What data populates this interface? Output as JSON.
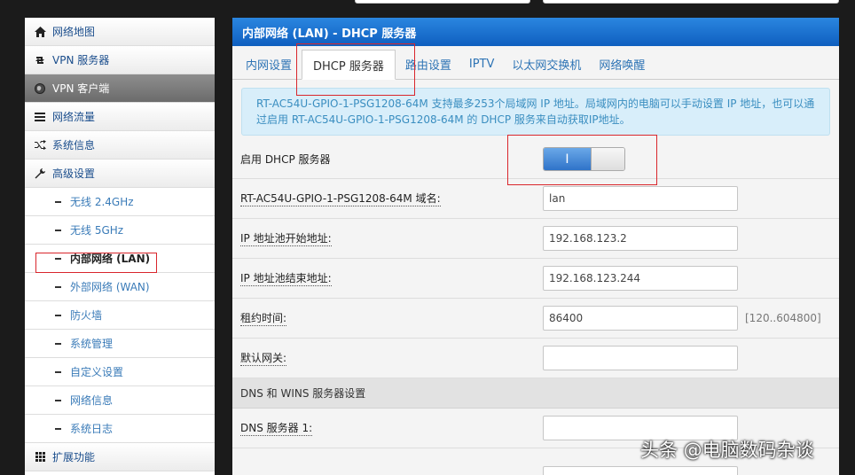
{
  "sidebar": {
    "items": [
      {
        "label": "网络地图",
        "icon": "home-icon"
      },
      {
        "label": "VPN 服务器",
        "icon": "retweet-icon"
      },
      {
        "label": "VPN 客户端",
        "icon": "globe-icon"
      },
      {
        "label": "网络流量",
        "icon": "list-icon"
      },
      {
        "label": "系统信息",
        "icon": "shuffle-icon"
      },
      {
        "label": "高级设置",
        "icon": "wrench-icon"
      }
    ],
    "sub_items": [
      "无线 2.4GHz",
      "无线 5GHz",
      "内部网络 (LAN)",
      "外部网络 (WAN)",
      "防火墙",
      "系统管理",
      "自定义设置",
      "网络信息",
      "系统日志"
    ],
    "extension": {
      "label": "扩展功能",
      "icon": "grid-icon"
    }
  },
  "panel": {
    "title": "内部网络 (LAN) - DHCP 服务器",
    "tabs": [
      "内网设置",
      "DHCP 服务器",
      "路由设置",
      "IPTV",
      "以太网交换机",
      "网络唤醒"
    ],
    "info": "RT-AC54U-GPIO-1-PSG1208-64M 支持最多253个局域网 IP 地址。局域网内的电脑可以手动设置 IP 地址，也可以通过启用 RT-AC54U-GPIO-1-PSG1208-64M 的 DHCP 服务来自动获取IP地址。",
    "enable_label": "启用 DHCP 服务器",
    "toggle_on_text": "I",
    "rows": [
      {
        "label": "RT-AC54U-GPIO-1-PSG1208-64M 域名:",
        "value": "lan"
      },
      {
        "label": "IP 地址池开始地址:",
        "value": "192.168.123.2"
      },
      {
        "label": "IP 地址池结束地址:",
        "value": "192.168.123.244"
      },
      {
        "label": "租约时间:",
        "value": "86400",
        "hint": "[120..604800]"
      },
      {
        "label": "默认网关:",
        "value": ""
      }
    ],
    "dns_section": "DNS 和 WINS 服务器设置",
    "dns_rows": [
      {
        "label": "DNS 服务器 1:",
        "value": ""
      }
    ]
  },
  "watermark": "头条 @电脑数码杂谈"
}
